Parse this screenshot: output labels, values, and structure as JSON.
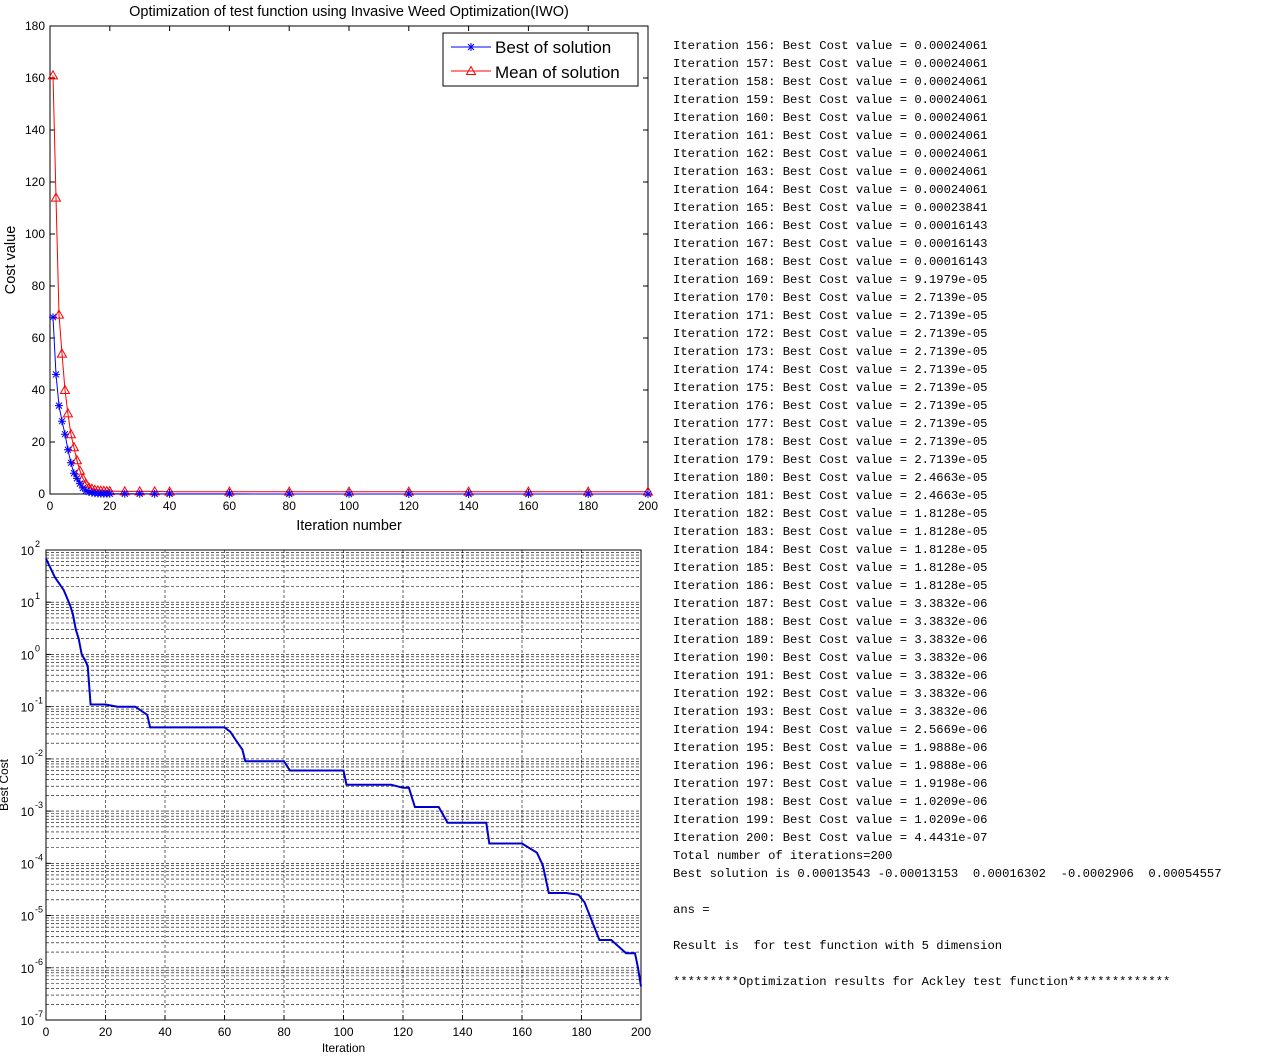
{
  "chart_data": [
    {
      "type": "line",
      "title": "Optimization of test function using Invasive Weed Optimization(IWO)",
      "xlabel": "Iteration number",
      "ylabel": "Cost value",
      "xlim": [
        0,
        200
      ],
      "ylim": [
        0,
        180
      ],
      "xticks": [
        "0",
        "20",
        "40",
        "60",
        "80",
        "100",
        "120",
        "140",
        "160",
        "180",
        "200"
      ],
      "yticks": [
        "0",
        "20",
        "40",
        "60",
        "80",
        "100",
        "120",
        "140",
        "160",
        "180"
      ],
      "legend": "top-right",
      "grid": false,
      "series": [
        {
          "name": "Best of solution",
          "color": "#0000ff",
          "marker": "asterisk",
          "x": [
            1,
            2,
            3,
            4,
            5,
            6,
            7,
            8,
            9,
            10,
            11,
            12,
            13,
            14,
            15,
            16,
            17,
            18,
            19,
            20,
            25,
            30,
            35,
            40,
            60,
            80,
            100,
            120,
            140,
            160,
            180,
            200
          ],
          "y": [
            68,
            46,
            34,
            28,
            23,
            17,
            12,
            8,
            6,
            4,
            2.3,
            1.2,
            0.8,
            0.5,
            0.3,
            0.2,
            0.15,
            0.12,
            0.11,
            0.11,
            0.1,
            0.1,
            0.04,
            0.04,
            0.04,
            0.009,
            0.006,
            0.003,
            0.0006,
            0.00024,
            2e-05,
            4e-07
          ]
        },
        {
          "name": "Mean of solution",
          "color": "#ff0000",
          "marker": "triangle",
          "x": [
            1,
            2,
            3,
            4,
            5,
            6,
            7,
            8,
            9,
            10,
            11,
            12,
            13,
            14,
            15,
            16,
            17,
            18,
            19,
            20,
            25,
            30,
            35,
            40,
            60,
            80,
            100,
            120,
            140,
            160,
            180,
            200
          ],
          "y": [
            161,
            114,
            69,
            54,
            40,
            31,
            23,
            18,
            13,
            9,
            6,
            4,
            2.5,
            2,
            1.6,
            1.4,
            1.3,
            1.2,
            1.1,
            1.1,
            1,
            1,
            1,
            0.9,
            0.9,
            0.9,
            0.9,
            0.9,
            0.9,
            0.9,
            0.9,
            0.9
          ]
        }
      ]
    },
    {
      "type": "line",
      "title": "",
      "xlabel": "Iteration",
      "ylabel": "Best Cost",
      "yscale": "log",
      "xlim": [
        0,
        200
      ],
      "ylim": [
        1e-07,
        100
      ],
      "xticks": [
        "0",
        "20",
        "40",
        "60",
        "80",
        "100",
        "120",
        "140",
        "160",
        "180",
        "200"
      ],
      "yticks_exp": [
        "2",
        "1",
        "0",
        "-1",
        "-2",
        "-3",
        "-4",
        "-5",
        "-6",
        "-7"
      ],
      "grid": true,
      "series": [
        {
          "color": "#0000cc",
          "x": [
            0,
            3,
            6,
            8,
            9,
            10,
            11,
            12,
            13,
            14,
            15,
            20,
            24,
            30,
            34,
            35,
            60,
            62,
            64,
            66,
            67,
            80,
            82,
            100,
            101,
            104,
            116,
            120,
            122,
            124,
            132,
            135,
            140,
            148,
            149,
            160,
            165,
            167,
            169,
            175,
            179,
            181,
            186,
            190,
            195,
            198,
            199,
            200
          ],
          "y": [
            68,
            30,
            17,
            9,
            6,
            3,
            2,
            1,
            0.8,
            0.6,
            0.11,
            0.11,
            0.1,
            0.1,
            0.07,
            0.04,
            0.04,
            0.033,
            0.022,
            0.015,
            0.009,
            0.009,
            0.006,
            0.006,
            0.0032,
            0.0032,
            0.0032,
            0.0028,
            0.0028,
            0.0012,
            0.0012,
            0.0006,
            0.0006,
            0.0006,
            0.00024,
            0.00024,
            0.00016,
            9.2e-05,
            2.7e-05,
            2.7e-05,
            2.5e-05,
            1.8e-05,
            3.4e-06,
            3.4e-06,
            1.9e-06,
            1.9e-06,
            1e-06,
            4.4e-07
          ]
        }
      ]
    }
  ],
  "console": {
    "lines": [
      "Iteration 156: Best Cost value = 0.00024061",
      "Iteration 157: Best Cost value = 0.00024061",
      "Iteration 158: Best Cost value = 0.00024061",
      "Iteration 159: Best Cost value = 0.00024061",
      "Iteration 160: Best Cost value = 0.00024061",
      "Iteration 161: Best Cost value = 0.00024061",
      "Iteration 162: Best Cost value = 0.00024061",
      "Iteration 163: Best Cost value = 0.00024061",
      "Iteration 164: Best Cost value = 0.00024061",
      "Iteration 165: Best Cost value = 0.00023841",
      "Iteration 166: Best Cost value = 0.00016143",
      "Iteration 167: Best Cost value = 0.00016143",
      "Iteration 168: Best Cost value = 0.00016143",
      "Iteration 169: Best Cost value = 9.1979e-05",
      "Iteration 170: Best Cost value = 2.7139e-05",
      "Iteration 171: Best Cost value = 2.7139e-05",
      "Iteration 172: Best Cost value = 2.7139e-05",
      "Iteration 173: Best Cost value = 2.7139e-05",
      "Iteration 174: Best Cost value = 2.7139e-05",
      "Iteration 175: Best Cost value = 2.7139e-05",
      "Iteration 176: Best Cost value = 2.7139e-05",
      "Iteration 177: Best Cost value = 2.7139e-05",
      "Iteration 178: Best Cost value = 2.7139e-05",
      "Iteration 179: Best Cost value = 2.7139e-05",
      "Iteration 180: Best Cost value = 2.4663e-05",
      "Iteration 181: Best Cost value = 2.4663e-05",
      "Iteration 182: Best Cost value = 1.8128e-05",
      "Iteration 183: Best Cost value = 1.8128e-05",
      "Iteration 184: Best Cost value = 1.8128e-05",
      "Iteration 185: Best Cost value = 1.8128e-05",
      "Iteration 186: Best Cost value = 1.8128e-05",
      "Iteration 187: Best Cost value = 3.3832e-06",
      "Iteration 188: Best Cost value = 3.3832e-06",
      "Iteration 189: Best Cost value = 3.3832e-06",
      "Iteration 190: Best Cost value = 3.3832e-06",
      "Iteration 191: Best Cost value = 3.3832e-06",
      "Iteration 192: Best Cost value = 3.3832e-06",
      "Iteration 193: Best Cost value = 3.3832e-06",
      "Iteration 194: Best Cost value = 2.5669e-06",
      "Iteration 195: Best Cost value = 1.9888e-06",
      "Iteration 196: Best Cost value = 1.9888e-06",
      "Iteration 197: Best Cost value = 1.9198e-06",
      "Iteration 198: Best Cost value = 1.0209e-06",
      "Iteration 199: Best Cost value = 1.0209e-06",
      "Iteration 200: Best Cost value = 4.4431e-07",
      "Total number of iterations=200",
      "Best solution is 0.00013543 -0.00013153  0.00016302  -0.0002906  0.00054557",
      "",
      "ans =",
      "",
      "Result is  for test function with 5 dimension",
      "",
      "*********Optimization results for Ackley test function**************"
    ]
  }
}
